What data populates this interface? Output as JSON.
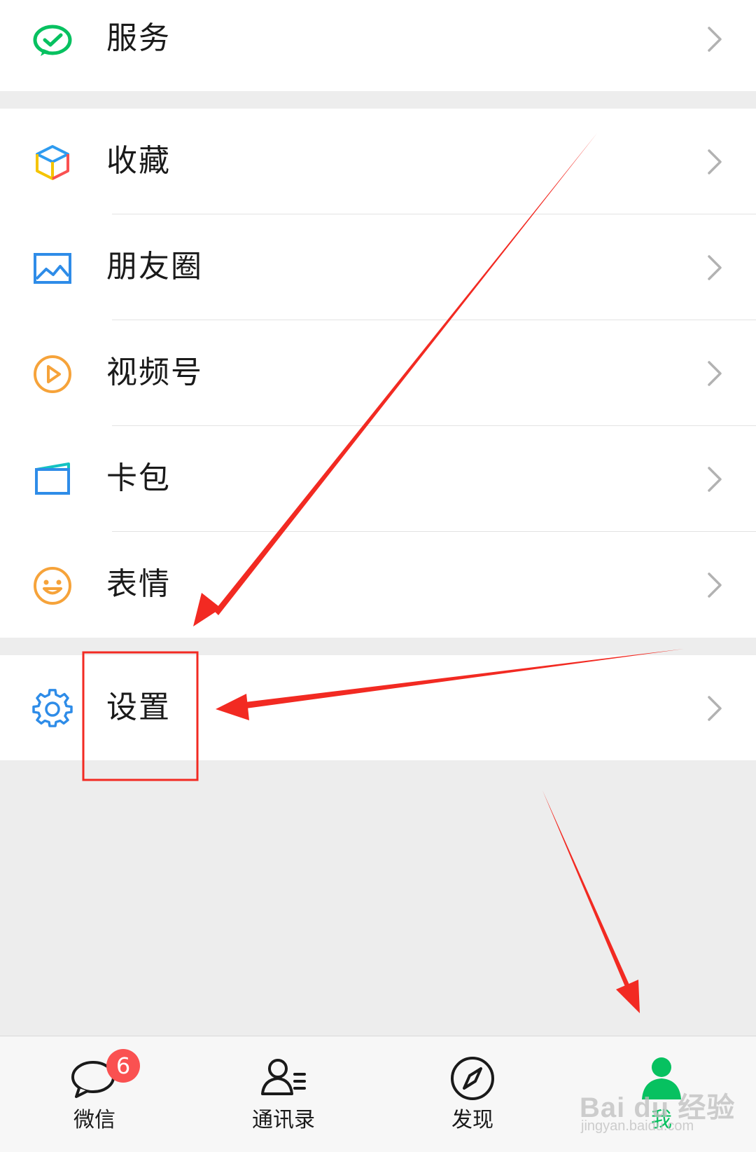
{
  "menu": {
    "service": {
      "label": "服务",
      "icon": "wechat-pay-service-icon",
      "color": "#07c160"
    },
    "items": [
      {
        "label": "收藏",
        "icon": "favorites-cube-icon"
      },
      {
        "label": "朋友圈",
        "icon": "moments-picture-icon"
      },
      {
        "label": "视频号",
        "icon": "channels-play-icon"
      },
      {
        "label": "卡包",
        "icon": "card-wallet-icon"
      },
      {
        "label": "表情",
        "icon": "sticker-smile-icon"
      }
    ],
    "settings": {
      "label": "设置",
      "icon": "gear-icon"
    }
  },
  "tabbar": {
    "tabs": [
      {
        "label": "微信",
        "icon": "chat-bubble-icon",
        "badge": "6"
      },
      {
        "label": "通讯录",
        "icon": "contacts-icon"
      },
      {
        "label": "发现",
        "icon": "compass-icon"
      },
      {
        "label": "我",
        "icon": "me-person-icon",
        "active": true
      }
    ],
    "active_color": "#07c160",
    "badge_color": "#fa5151"
  },
  "watermark": {
    "text": "Bai du 经验",
    "sub": "jingyan.baidu.com"
  },
  "annotation_color": "#f22a22"
}
